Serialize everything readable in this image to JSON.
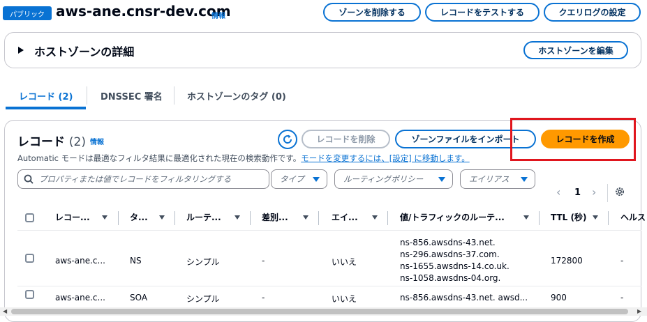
{
  "header": {
    "badge": "パブリック",
    "title": "aws-ane.cnsr-dev.com",
    "info": "情報",
    "buttons": {
      "delete_zone": "ゾーンを削除する",
      "test_record": "レコードをテストする",
      "query_log": "クエリログの設定"
    }
  },
  "details": {
    "title": "ホストゾーンの詳細",
    "edit_button": "ホストゾーンを編集"
  },
  "tabs": [
    {
      "label": "レコード (2)",
      "active": true
    },
    {
      "label": "DNSSEC 署名",
      "active": false
    },
    {
      "label": "ホストゾーンのタグ (0)",
      "active": false
    }
  ],
  "records": {
    "heading": "レコード",
    "count": "(2)",
    "info": "情報",
    "delete_button": "レコードを削除",
    "import_button": "ゾーンファイルをインポート",
    "create_button": "レコードを作成",
    "description_prefix": "Automatic モードは最適なフィルタ結果に最適化された現在の検索動作です。",
    "description_link": "モードを変更するには、[設定] に移動します。",
    "search_placeholder": "プロパティまたは値でレコードをフィルタリングする",
    "filters": {
      "type": "タイプ",
      "routing_policy": "ルーティングポリシー",
      "alias": "エイリアス"
    },
    "pagination": {
      "page": "1"
    },
    "columns": [
      "レコー...",
      "タ...",
      "ルーテ...",
      "差別...",
      "エイ...",
      "値/トラフィックのルーテ...",
      "TTL (秒)",
      "ヘルス"
    ],
    "rows": [
      {
        "name": "aws-ane.c...",
        "type": "NS",
        "routing": "シンプル",
        "differentiator": "-",
        "alias": "いいえ",
        "values": [
          "ns-856.awsdns-43.net.",
          "ns-296.awsdns-37.com.",
          "ns-1655.awsdns-14.co.uk.",
          "ns-1058.awsdns-04.org."
        ],
        "ttl": "172800",
        "health": "-"
      },
      {
        "name": "aws-ane.c...",
        "type": "SOA",
        "routing": "シンプル",
        "differentiator": "-",
        "alias": "いいえ",
        "values": [
          "ns-856.awsdns-43.net. awsd..."
        ],
        "ttl": "900",
        "health": "-"
      }
    ]
  },
  "colors": {
    "accent": "#0972d3",
    "primary": "#ff9900",
    "highlight": "#e0161e"
  }
}
